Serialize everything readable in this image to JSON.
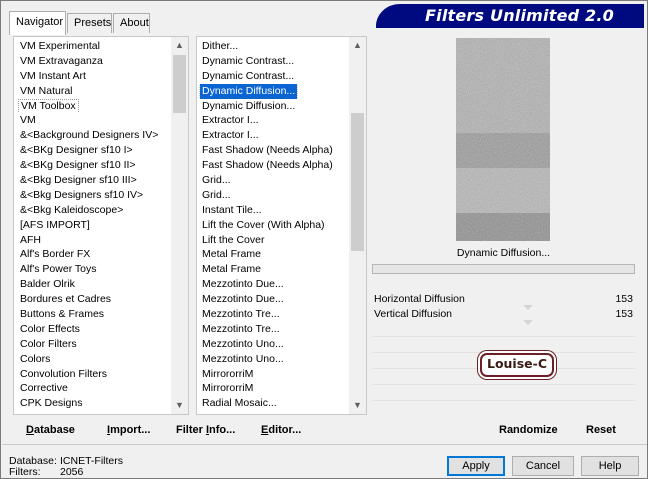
{
  "tabs": [
    "Navigator",
    "Presets",
    "About"
  ],
  "banner_title": "Filters Unlimited 2.0",
  "categories": [
    "VM Experimental",
    "VM Extravaganza",
    "VM Instant Art",
    "VM Natural",
    "VM Toolbox",
    "VM",
    "&<Background Designers IV>",
    "&<BKg Designer sf10 I>",
    "&<BKg Designer sf10 II>",
    "&<Bkg Designer sf10 III>",
    "&<Bkg Designers sf10 IV>",
    "&<Bkg Kaleidoscope>",
    "[AFS IMPORT]",
    "AFH",
    "Alf's Border FX",
    "Alf's Power Toys",
    "Balder Olrik",
    "Bordures et Cadres",
    "Buttons & Frames",
    "Color Effects",
    "Color Filters",
    "Colors",
    "Convolution Filters",
    "Corrective",
    "CPK Designs"
  ],
  "selected_category": "VM Toolbox",
  "filters": [
    "Dither...",
    "Dynamic Contrast...",
    "Dynamic Contrast...",
    "Dynamic Diffusion...",
    "Dynamic Diffusion...",
    "Extractor I...",
    "Extractor I...",
    "Fast Shadow (Needs Alpha)",
    "Fast Shadow (Needs Alpha)",
    "Grid...",
    "Grid...",
    "Instant Tile...",
    "Lift the Cover (With Alpha)",
    "Lift the Cover",
    "Metal Frame",
    "Metal Frame",
    "Mezzotinto Due...",
    "Mezzotinto Due...",
    "Mezzotinto Tre...",
    "Mezzotinto Tre...",
    "Mezzotinto Uno...",
    "Mezzotinto Uno...",
    "MirrororriM",
    "MirrororriM",
    "Radial Mosaic..."
  ],
  "selected_filter": "Dynamic Diffusion...",
  "filter_title": "Dynamic Diffusion...",
  "params": [
    {
      "name": "Horizontal Diffusion",
      "value": "153"
    },
    {
      "name": "Vertical Diffusion",
      "value": "153"
    }
  ],
  "logo_text": "Louise-C",
  "bottom_buttons": {
    "database": {
      "u": "D",
      "rest": "atabase"
    },
    "import": {
      "u": "I",
      "rest": "mport..."
    },
    "filterinfo": {
      "pre": "Filter ",
      "u": "I",
      "rest": "nfo..."
    },
    "editor": {
      "u": "E",
      "rest": "ditor..."
    },
    "randomize": "Randomize",
    "reset": "Reset"
  },
  "status": {
    "database_label": "Database:",
    "database_value": "ICNET-Filters",
    "filters_label": "Filters:",
    "filters_value": "2056"
  },
  "buttons": {
    "apply": "Apply",
    "cancel": "Cancel",
    "help": "Help"
  },
  "colors": {
    "banner": "#000a80",
    "selection": "#0a64d2",
    "logo_border": "#6b1f26"
  }
}
